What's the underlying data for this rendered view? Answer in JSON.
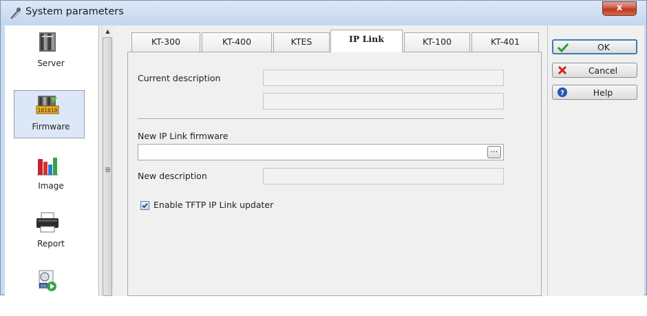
{
  "window": {
    "title": "System parameters",
    "close_glyph": "x"
  },
  "sidebar": {
    "items": [
      {
        "label": "Server",
        "icon": "server-icon"
      },
      {
        "label": "Firmware",
        "icon": "firmware-icon",
        "selected": true
      },
      {
        "label": "Image",
        "icon": "image-chart-icon"
      },
      {
        "label": "Report",
        "icon": "printer-icon"
      },
      {
        "label": "",
        "icon": "video-icon"
      }
    ]
  },
  "tabs": [
    {
      "label": "KT-300"
    },
    {
      "label": "KT-400"
    },
    {
      "label": "KTES"
    },
    {
      "label": "IP Link",
      "active": true
    },
    {
      "label": "KT-100"
    },
    {
      "label": "KT-401"
    }
  ],
  "panel": {
    "current_description_label": "Current description",
    "current_description_value_1": "",
    "current_description_value_2": "",
    "new_firmware_label": "New IP Link firmware",
    "new_firmware_value": "",
    "browse_label": "...",
    "new_description_label": "New description",
    "new_description_value": "",
    "tftp_checkbox_label": "Enable TFTP IP Link updater",
    "tftp_checkbox_checked": true
  },
  "buttons": {
    "ok": "OK",
    "cancel": "Cancel",
    "help": "Help"
  },
  "colors": {
    "ok_check": "#2a9a2a",
    "cancel_x": "#d81e1e",
    "help_icon": "#2456b4"
  }
}
